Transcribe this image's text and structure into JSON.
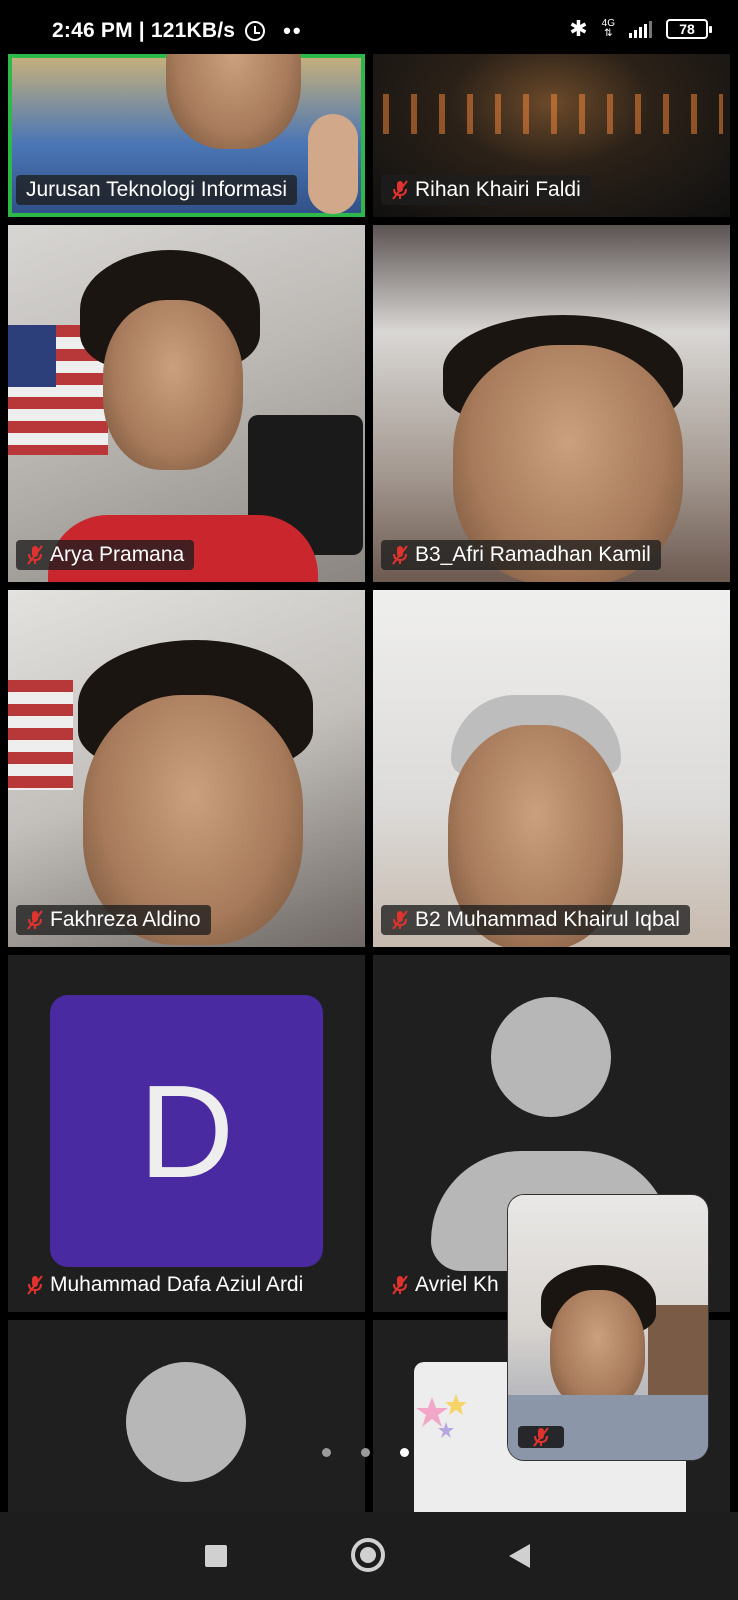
{
  "status_bar": {
    "time": "2:46 PM",
    "speed": "| 121KB/s",
    "network": "4G",
    "battery": "78"
  },
  "participants": [
    {
      "name": "Jurusan Teknologi Informasi",
      "muted": false,
      "active_speaker": true
    },
    {
      "name": "Rihan Khairi Faldi",
      "muted": true
    },
    {
      "name": "Arya Pramana",
      "muted": true
    },
    {
      "name": "B3_Afri Ramadhan Kamil",
      "muted": true
    },
    {
      "name": "Fakhreza Aldino",
      "muted": true
    },
    {
      "name": "B2 Muhammad Khairul Iqbal",
      "muted": true
    },
    {
      "name": "Muhammad Dafa Aziul Ardi",
      "muted": true,
      "avatar_letter": "D",
      "avatar_color": "#4a2aa0"
    },
    {
      "name": "Avriel Kh",
      "muted": true
    }
  ],
  "colors": {
    "active_border": "#2fb84a",
    "muted_icon": "#e0332e"
  },
  "pager": {
    "pages": 3,
    "current": 3
  }
}
